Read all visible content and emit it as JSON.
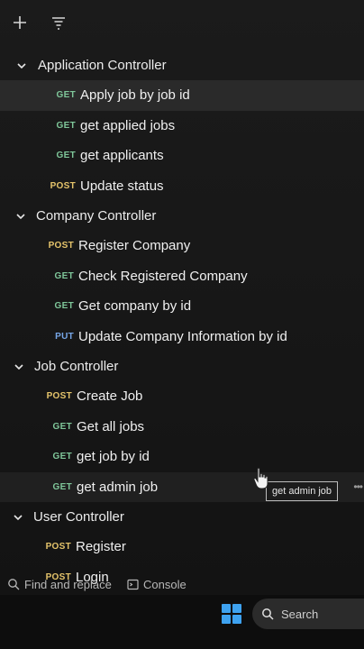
{
  "toolbar": {
    "add_icon": "plus-icon",
    "filter_icon": "filter-icon"
  },
  "tree": [
    {
      "label": "Application Controller",
      "requests": [
        {
          "method": "GET",
          "label": "Apply job by job id",
          "state": "active"
        },
        {
          "method": "GET",
          "label": "get applied jobs"
        },
        {
          "method": "GET",
          "label": "get applicants"
        },
        {
          "method": "POST",
          "label": "Update status"
        }
      ]
    },
    {
      "label": "Company Controller",
      "requests": [
        {
          "method": "POST",
          "label": "Register Company"
        },
        {
          "method": "GET",
          "label": "Check Registered Company"
        },
        {
          "method": "GET",
          "label": "Get company by id"
        },
        {
          "method": "PUT",
          "label": "Update Company Information by id"
        }
      ]
    },
    {
      "label": "Job Controller",
      "requests": [
        {
          "method": "POST",
          "label": "Create Job"
        },
        {
          "method": "GET",
          "label": "Get all jobs"
        },
        {
          "method": "GET",
          "label": "get job by id"
        },
        {
          "method": "GET",
          "label": "get admin job",
          "state": "hover"
        }
      ]
    },
    {
      "label": "User Controller",
      "requests": [
        {
          "method": "POST",
          "label": "Register"
        },
        {
          "method": "POST",
          "label": "Login"
        }
      ]
    }
  ],
  "tooltip": "get admin job",
  "more_dots": "•••",
  "statusbar": {
    "find_replace": "Find and replace",
    "console": "Console"
  },
  "taskbar": {
    "search_label": "Search"
  },
  "colors": {
    "get": "#7fc79a",
    "post": "#e5c46b",
    "put": "#77a7e8"
  }
}
